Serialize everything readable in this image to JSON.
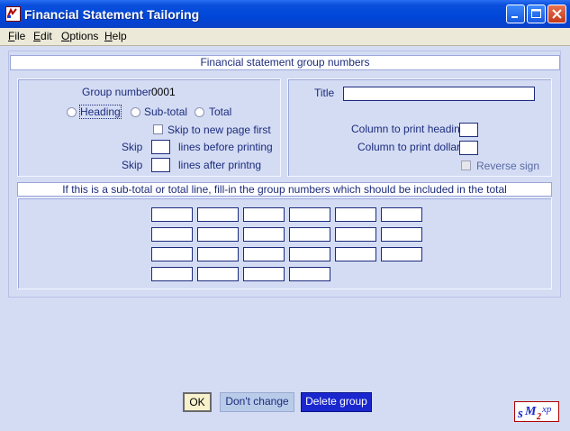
{
  "window": {
    "title": "Financial Statement Tailoring",
    "icon": "app-icon"
  },
  "menu": {
    "file": "File",
    "edit": "Edit",
    "options": "Options",
    "help": "Help"
  },
  "header": {
    "title": "Financial statement group numbers"
  },
  "group": {
    "number_label": "Group number",
    "number_value": "0001",
    "radio_heading": "Heading",
    "radio_subtotal": "Sub-total",
    "radio_total": "Total",
    "skip_new_page": "Skip to new page first",
    "skip1_label": "Skip",
    "lines_before": "lines before printing",
    "skip2_label": "Skip",
    "lines_after": "lines after printng"
  },
  "right": {
    "title_label": "Title",
    "col_heading_label": "Column to print heading",
    "col_dollars_label": "Column to print dollars",
    "reverse_sign_label": "Reverse sign"
  },
  "subtotal": {
    "instruction": "If this is a sub-total or total line, fill-in the group numbers which should be included in the total"
  },
  "buttons": {
    "ok": "OK",
    "dont_change": "Don't change",
    "delete_group": "Delete group"
  },
  "logo": {
    "text": "sM2xp"
  },
  "colors": {
    "window_bg": "#d4dcf4",
    "text": "#1c2c7c",
    "delete_button": "#1a27ce",
    "ok_button": "#f7f1cc",
    "dont_change_button": "#b8cbe8",
    "titlebar": "#0047d8"
  }
}
